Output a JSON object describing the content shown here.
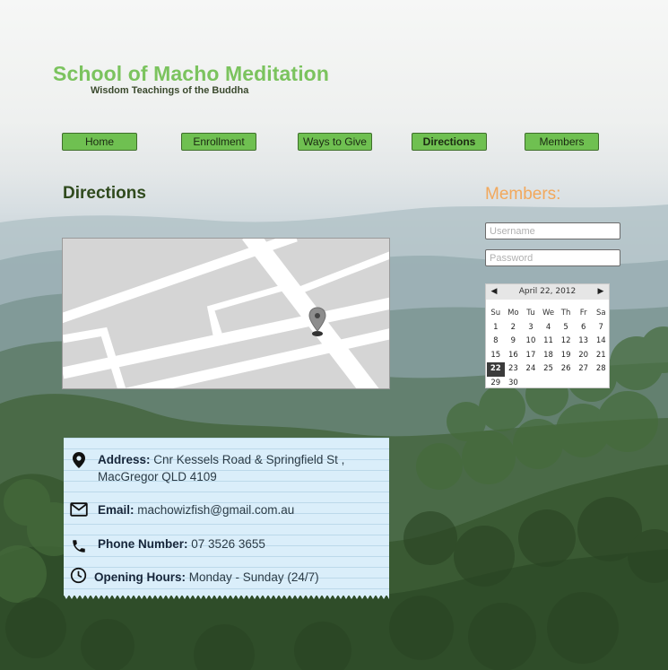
{
  "site": {
    "title": "School of Macho Meditation",
    "tagline": "Wisdom Teachings of the Buddha"
  },
  "nav": [
    {
      "label": "Home"
    },
    {
      "label": "Enrollment"
    },
    {
      "label": "Ways to Give"
    },
    {
      "label": "Directions",
      "active": true
    },
    {
      "label": "Members"
    }
  ],
  "page": {
    "title": "Directions"
  },
  "contact": {
    "address_label": "Address:",
    "address_line1": "Cnr Kessels Road & Springfield St ,",
    "address_line2": "MacGregor QLD 4109",
    "email_label": "Email:",
    "email_value": "machowizfish@gmail.com.au",
    "phone_label": "Phone Number:",
    "phone_value": "07 3526 3655",
    "hours_label": "Opening Hours:",
    "hours_value": "Monday - Sunday (24/7)"
  },
  "members": {
    "title": "Members:",
    "username_placeholder": "Username",
    "password_placeholder": "Password"
  },
  "calendar": {
    "month_label": "April 22, 2012",
    "prev": "◀",
    "next": "▶",
    "weekdays": [
      "Su",
      "Mo",
      "Tu",
      "We",
      "Th",
      "Fr",
      "Sa"
    ],
    "weeks": [
      [
        "1",
        "2",
        "3",
        "4",
        "5",
        "6",
        "7"
      ],
      [
        "8",
        "9",
        "10",
        "11",
        "12",
        "13",
        "14"
      ],
      [
        "15",
        "16",
        "17",
        "18",
        "19",
        "20",
        "21"
      ],
      [
        "22",
        "23",
        "24",
        "25",
        "26",
        "27",
        "28"
      ],
      [
        "29",
        "30",
        "",
        "",
        "",
        "",
        ""
      ]
    ],
    "selected": "22"
  },
  "colors": {
    "title_green": "#7bc35e",
    "nav_green": "#6fc051",
    "members_orange": "#f2a85c",
    "card_blue": "#daeefa"
  },
  "icons": {
    "address": "map-pin-icon",
    "email": "envelope-icon",
    "phone": "phone-icon",
    "hours": "clock-icon",
    "map_marker": "map-marker-icon"
  }
}
